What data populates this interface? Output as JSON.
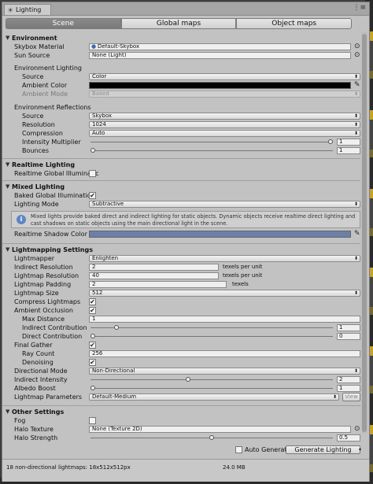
{
  "window": {
    "tab_title": "Lighting",
    "menu_icon": "menu-icon"
  },
  "toolbar": {
    "tabs": [
      "Scene",
      "Global maps",
      "Object maps"
    ],
    "active": 0
  },
  "environment": {
    "header": "Environment",
    "skybox_label": "Skybox Material",
    "skybox_value": "Default-Skybox",
    "sun_label": "Sun Source",
    "sun_value": "None (Light)",
    "lighting_header": "Environment Lighting",
    "source_label": "Source",
    "source_value": "Color",
    "ambient_color_label": "Ambient Color",
    "ambient_color": "#000000",
    "ambient_mode_label": "Ambient Mode",
    "ambient_mode_value": "Baked",
    "reflections_header": "Environment Reflections",
    "refl_source_label": "Source",
    "refl_source_value": "Skybox",
    "resolution_label": "Resolution",
    "resolution_value": "1024",
    "compression_label": "Compression",
    "compression_value": "Auto",
    "intensity_label": "Intensity Multiplier",
    "intensity_value": "1",
    "intensity_fraction": 1.0,
    "bounces_label": "Bounces",
    "bounces_value": "1",
    "bounces_fraction": 0.0
  },
  "realtime": {
    "header": "Realtime Lighting",
    "gi_label": "Realtime Global Illuminatic",
    "gi_checked": false
  },
  "mixed": {
    "header": "Mixed Lighting",
    "baked_gi_label": "Baked Global Illumination",
    "baked_gi_checked": true,
    "mode_label": "Lighting Mode",
    "mode_value": "Subtractive",
    "help_text": "Mixed lights provide baked direct and indirect lighting for static objects. Dynamic objects receive realtime direct lighting and cast shadows on static objects using the main directional light in the scene.",
    "shadow_color_label": "Realtime Shadow Color",
    "shadow_color": "#6b7fa8"
  },
  "lightmapping": {
    "header": "Lightmapping Settings",
    "lightmapper_label": "Lightmapper",
    "lightmapper_value": "Enlighten",
    "indirect_res_label": "Indirect Resolution",
    "indirect_res_value": "2",
    "indirect_res_unit": "texels per unit",
    "lightmap_res_label": "Lightmap Resolution",
    "lightmap_res_value": "40",
    "lightmap_res_unit": "texels per unit",
    "padding_label": "Lightmap Padding",
    "padding_value": "2",
    "padding_unit": "texels",
    "size_label": "Lightmap Size",
    "size_value": "512",
    "compress_label": "Compress Lightmaps",
    "compress_checked": true,
    "ao_label": "Ambient Occlusion",
    "ao_checked": true,
    "max_dist_label": "Max Distance",
    "max_dist_value": "1",
    "indirect_contrib_label": "Indirect Contribution",
    "indirect_contrib_value": "1",
    "indirect_contrib_fraction": 0.1,
    "direct_contrib_label": "Direct Contribution",
    "direct_contrib_value": "0",
    "direct_contrib_fraction": 0.0,
    "final_gather_label": "Final Gather",
    "final_gather_checked": true,
    "ray_count_label": "Ray Count",
    "ray_count_value": "256",
    "denoising_label": "Denoising",
    "denoising_checked": true,
    "dir_mode_label": "Directional Mode",
    "dir_mode_value": "Non-Directional",
    "indirect_intensity_label": "Indirect Intensity",
    "indirect_intensity_value": "2",
    "indirect_intensity_fraction": 0.4,
    "albedo_label": "Albedo Boost",
    "albedo_value": "1",
    "albedo_fraction": 0.0,
    "params_label": "Lightmap Parameters",
    "params_value": "Default-Medium",
    "view_button": "View"
  },
  "other": {
    "header": "Other Settings",
    "fog_label": "Fog",
    "fog_checked": false,
    "halo_tex_label": "Halo Texture",
    "halo_tex_value": "None (Texture 2D)",
    "halo_strength_label": "Halo Strength",
    "halo_strength_value": "0.5",
    "halo_strength_fraction": 0.5
  },
  "footer": {
    "auto_generate_label": "Auto Generate",
    "auto_generate_checked": false,
    "generate_button": "Generate Lighting",
    "status_left": "18 non-directional lightmaps: 18x512x512px",
    "status_right": "24.0 MB"
  }
}
